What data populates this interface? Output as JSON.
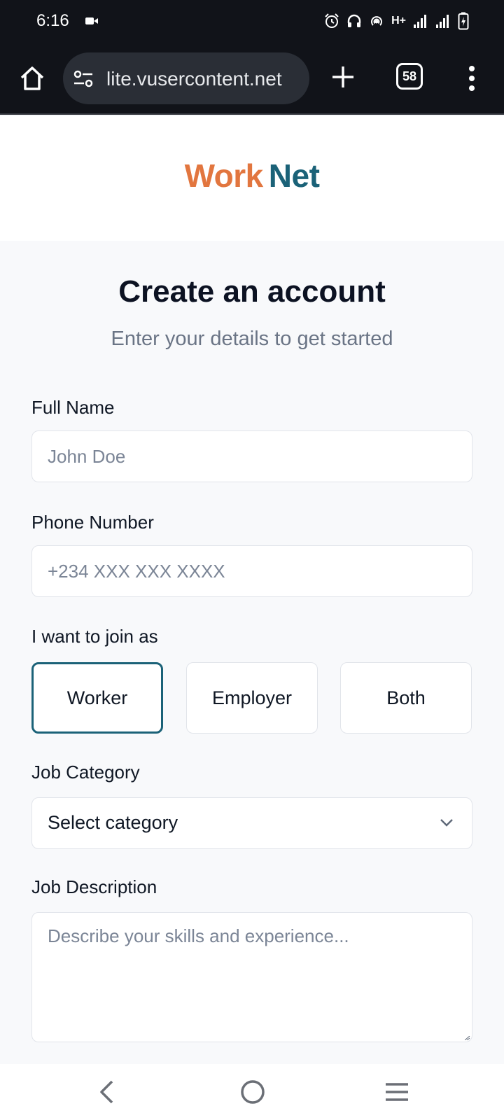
{
  "status_bar": {
    "time": "6:16",
    "network": "H+",
    "icons": [
      "video-camera-icon",
      "alarm-icon",
      "headphones-icon",
      "hotspot-icon",
      "signal-icon",
      "battery-charging-icon"
    ]
  },
  "browser": {
    "url": "lite.vusercontent.net",
    "tab_count": "58",
    "icons": [
      "home-icon",
      "site-settings-icon",
      "plus-icon",
      "more-vert-icon"
    ]
  },
  "header": {
    "logo_part1": "Work",
    "logo_part2": "Net",
    "colors": {
      "logo_work": "#e2763f",
      "logo_net": "#1b6278"
    }
  },
  "form": {
    "title": "Create an account",
    "subtitle": "Enter your details to get started",
    "full_name": {
      "label": "Full Name",
      "placeholder": "John Doe",
      "value": ""
    },
    "phone": {
      "label": "Phone Number",
      "placeholder": "+234 XXX XXX XXXX",
      "value": ""
    },
    "role": {
      "label": "I want to join as",
      "options": [
        "Worker",
        "Employer",
        "Both"
      ],
      "selected": "Worker"
    },
    "category": {
      "label": "Job Category",
      "value": "Select category"
    },
    "description": {
      "label": "Job Description",
      "placeholder": "Describe your skills and experience...",
      "value": ""
    }
  },
  "navigation_bar": {
    "icons": [
      "back-icon",
      "home-circle-icon",
      "recents-icon"
    ]
  }
}
